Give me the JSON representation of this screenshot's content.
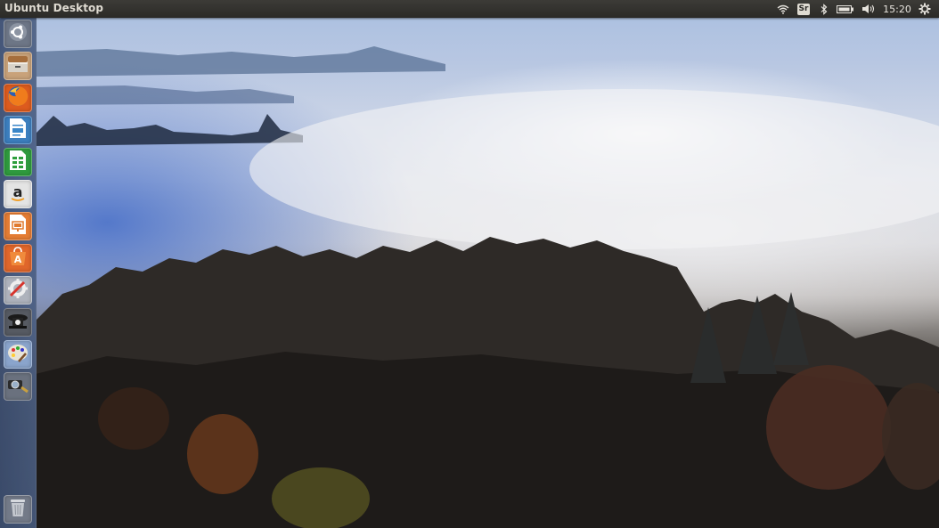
{
  "panel": {
    "title": "Ubuntu Desktop",
    "keyboard_layout": "Sr",
    "clock": "15:20",
    "indicators": [
      "wifi-icon",
      "keyboard-icon",
      "bluetooth-icon",
      "battery-icon",
      "volume-icon",
      "gear-icon"
    ]
  },
  "launcher": {
    "items": [
      {
        "name": "dash-home",
        "icon": "ubuntu-logo-icon",
        "color": "#6d7686"
      },
      {
        "name": "files",
        "icon": "file-cabinet-icon",
        "color": "#a87b52"
      },
      {
        "name": "firefox",
        "icon": "firefox-icon",
        "color": "#e66000"
      },
      {
        "name": "libreoffice-writer",
        "icon": "writer-document-icon",
        "color": "#3a86c8"
      },
      {
        "name": "libreoffice-calc",
        "icon": "calc-spreadsheet-icon",
        "color": "#2e9e3c"
      },
      {
        "name": "amazon",
        "icon": "amazon-icon",
        "color": "#dcdcdc"
      },
      {
        "name": "libreoffice-impress",
        "icon": "impress-presentation-icon",
        "color": "#e07a2e"
      },
      {
        "name": "ubuntu-software",
        "icon": "software-center-icon",
        "color": "#e0662a"
      },
      {
        "name": "system-settings",
        "icon": "settings-tools-icon",
        "color": "#b8bcc4"
      },
      {
        "name": "unity-tweak",
        "icon": "tweak-icon",
        "color": "#3a3a3a"
      },
      {
        "name": "appearance",
        "icon": "paint-palette-icon",
        "color": "#7a9ac8"
      },
      {
        "name": "screenshot",
        "icon": "magnifier-tool-icon",
        "color": "#5d6470"
      },
      {
        "name": "trash",
        "icon": "trash-icon",
        "color": "#7b8190"
      }
    ]
  }
}
